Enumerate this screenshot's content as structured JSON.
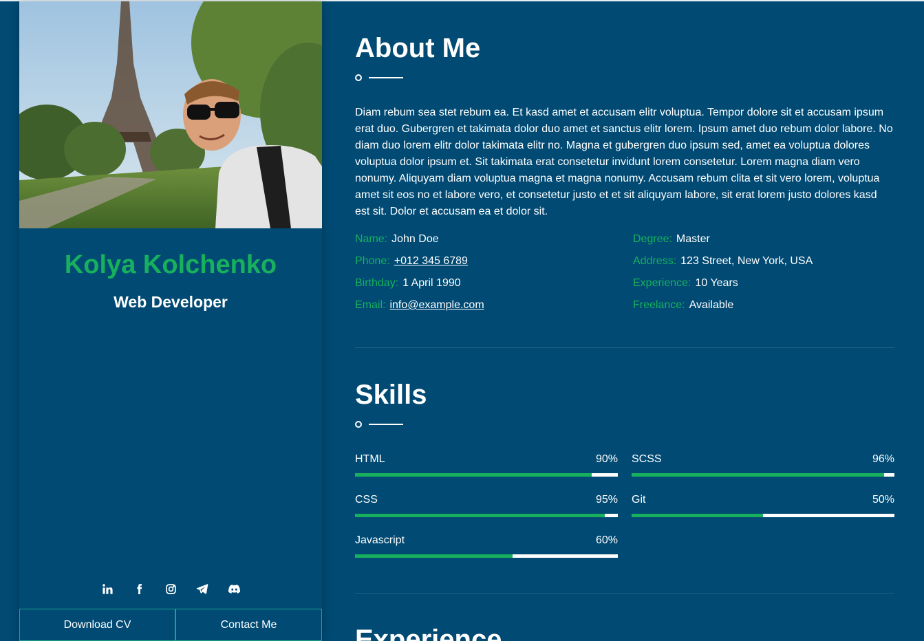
{
  "profile": {
    "name": "Kolya Kolchenko",
    "role": "Web Developer"
  },
  "socials": [
    "linkedin-icon",
    "facebook-icon",
    "instagram-icon",
    "telegram-icon",
    "discord-icon"
  ],
  "buttons": {
    "download": "Download CV",
    "contact": "Contact Me"
  },
  "about": {
    "title": "About Me",
    "text": "Diam rebum sea stet rebum ea. Et kasd amet et accusam elitr voluptua. Tempor dolore sit et accusam ipsum erat duo. Gubergren et takimata dolor duo amet et sanctus elitr lorem. Ipsum amet duo rebum dolor labore. No diam duo lorem elitr dolor takimata elitr no. Magna et gubergren duo ipsum sed, amet ea voluptua dolores voluptua dolor ipsum et. Sit takimata erat consetetur invidunt lorem consetetur. Lorem magna diam vero nonumy. Aliquyam diam voluptua magna et magna nonumy. Accusam rebum clita et sit vero lorem, voluptua amet sit eos no et labore vero, et consetetur justo et et sit aliquyam labore, sit erat lorem justo dolores kasd est sit. Dolor et accusam ea et dolor sit.",
    "info_left": [
      {
        "label": "Name:",
        "value": "John Doe"
      },
      {
        "label": "Phone:",
        "value": "+012 345 6789"
      },
      {
        "label": "Birthday:",
        "value": "1 April 1990"
      },
      {
        "label": "Email:",
        "value": "info@example.com"
      }
    ],
    "info_right": [
      {
        "label": "Degree:",
        "value": "Master"
      },
      {
        "label": "Address:",
        "value": "123 Street, New York, USA"
      },
      {
        "label": "Experience:",
        "value": "10 Years"
      },
      {
        "label": "Freelance:",
        "value": "Available"
      }
    ]
  },
  "skills": {
    "title": "Skills",
    "items": [
      {
        "name": "HTML",
        "percent_label": "90%",
        "level": 90
      },
      {
        "name": "SCSS",
        "percent_label": "96%",
        "level": 96
      },
      {
        "name": "CSS",
        "percent_label": "95%",
        "level": 95
      },
      {
        "name": "Git",
        "percent_label": "50%",
        "level": 50
      },
      {
        "name": "Javascript",
        "percent_label": "60%",
        "level": 60
      }
    ]
  },
  "experience": {
    "title": "Experience"
  },
  "colors": {
    "background": "#004a73",
    "accent": "#17b15d",
    "text": "#ffffff"
  }
}
